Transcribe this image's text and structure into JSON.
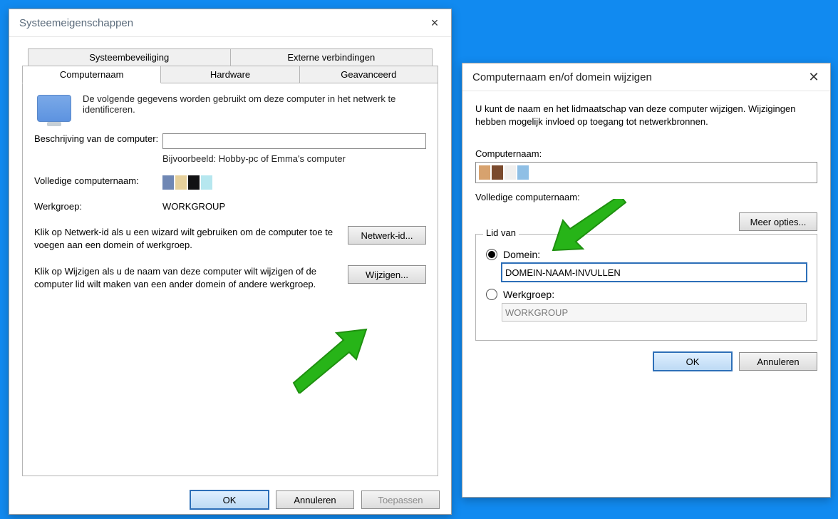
{
  "dlg1": {
    "title": "Systeemeigenschappen",
    "tabs_row1": [
      "Systeembeveiliging",
      "Externe verbindingen"
    ],
    "tabs_row2": [
      "Computernaam",
      "Hardware",
      "Geavanceerd"
    ],
    "head_text": "De volgende gegevens worden gebruikt om deze computer in het netwerk te identificeren.",
    "desc_label": "Beschrijving van de computer:",
    "desc_hint": "Bijvoorbeeld: Hobby-pc of Emma's computer",
    "full_label": "Volledige computernaam:",
    "workgroup_label": "Werkgroep:",
    "workgroup_value": "WORKGROUP",
    "row_networkid_text": "Klik op Netwerk-id als u een wizard wilt gebruiken om de computer toe te voegen aan een domein of werkgroep.",
    "btn_networkid": "Netwerk-id...",
    "row_change_text": "Klik op Wijzigen als u de naam van deze computer wilt wijzigen of de computer lid wilt maken van een ander domein of andere werkgroep.",
    "btn_change": "Wijzigen...",
    "btn_ok": "OK",
    "btn_cancel": "Annuleren",
    "btn_apply": "Toepassen"
  },
  "dlg2": {
    "title": "Computernaam en/of domein wijzigen",
    "intro": "U kunt de naam en het lidmaatschap van deze computer wijzigen. Wijzigingen hebben mogelijk invloed op toegang tot netwerkbronnen.",
    "comp_label": "Computernaam:",
    "full_label": "Volledige computernaam:",
    "btn_more": "Meer opties...",
    "group_legend": "Lid van",
    "opt_domain": "Domein:",
    "domain_value": "DOMEIN-NAAM-INVULLEN",
    "opt_workgroup": "Werkgroep:",
    "workgroup_value": "WORKGROUP",
    "btn_ok": "OK",
    "btn_cancel": "Annuleren"
  }
}
